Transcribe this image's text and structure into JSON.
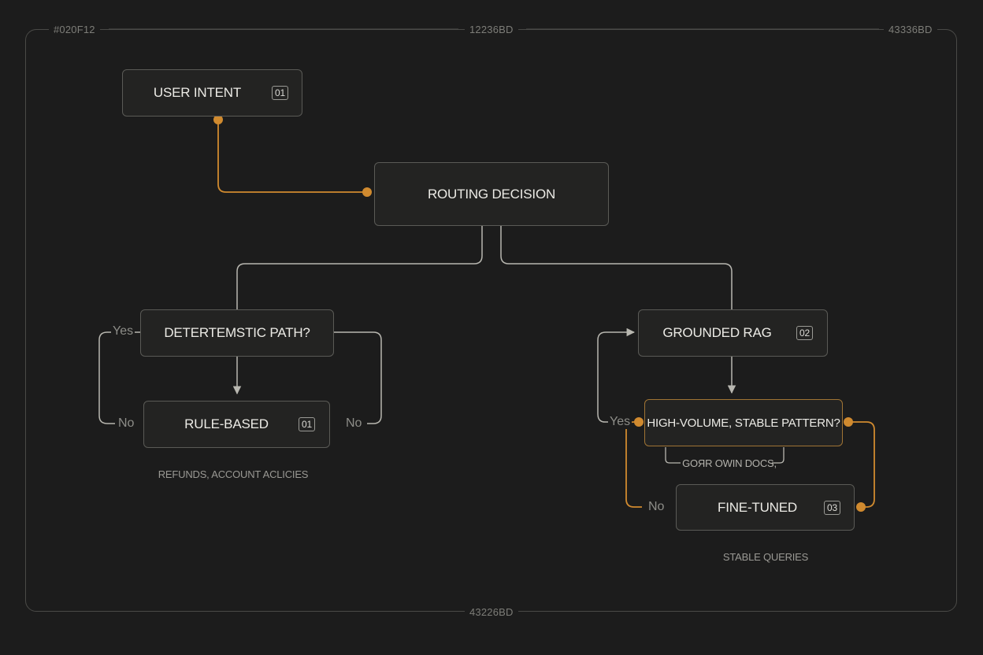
{
  "colors": {
    "background": "#1c1c1c",
    "node_border": "#5a5a56",
    "accent": "#d08a2f",
    "connector": "#b8b7b0",
    "text": "#ecebe6",
    "muted": "#8d8d88"
  },
  "frame_labels": {
    "top_left": "#020F12",
    "top_center": "12236BD",
    "top_right": "43336BD",
    "bottom_center": "43226BD"
  },
  "nodes": {
    "user_intent": {
      "label": "USER INTENT",
      "badge": "01"
    },
    "routing_decision": {
      "label": "ROUTING DECISION"
    },
    "deterministic_path": {
      "label": "DETERTEMSTIC PATH?"
    },
    "rule_based": {
      "label": "RULE-BASED",
      "badge": "01"
    },
    "grounded_rag": {
      "label": "GROUNDED RAG",
      "badge": "02"
    },
    "high_volume": {
      "label": "HIGH-VOLUME, STABLE PATTERN?"
    },
    "fine_tuned": {
      "label": "FINE-TUNED",
      "badge": "03"
    }
  },
  "edge_labels": {
    "det_yes": "Yes",
    "det_no_left": "No",
    "det_no_right": "No",
    "hv_yes": "Yes",
    "hv_no": "No"
  },
  "captions": {
    "rule_based": "REFUNDS, ACCOUNT ACLICIES",
    "high_volume": "GOЯR OWIN DOCS,",
    "fine_tuned": "STABLE QUERIES"
  }
}
